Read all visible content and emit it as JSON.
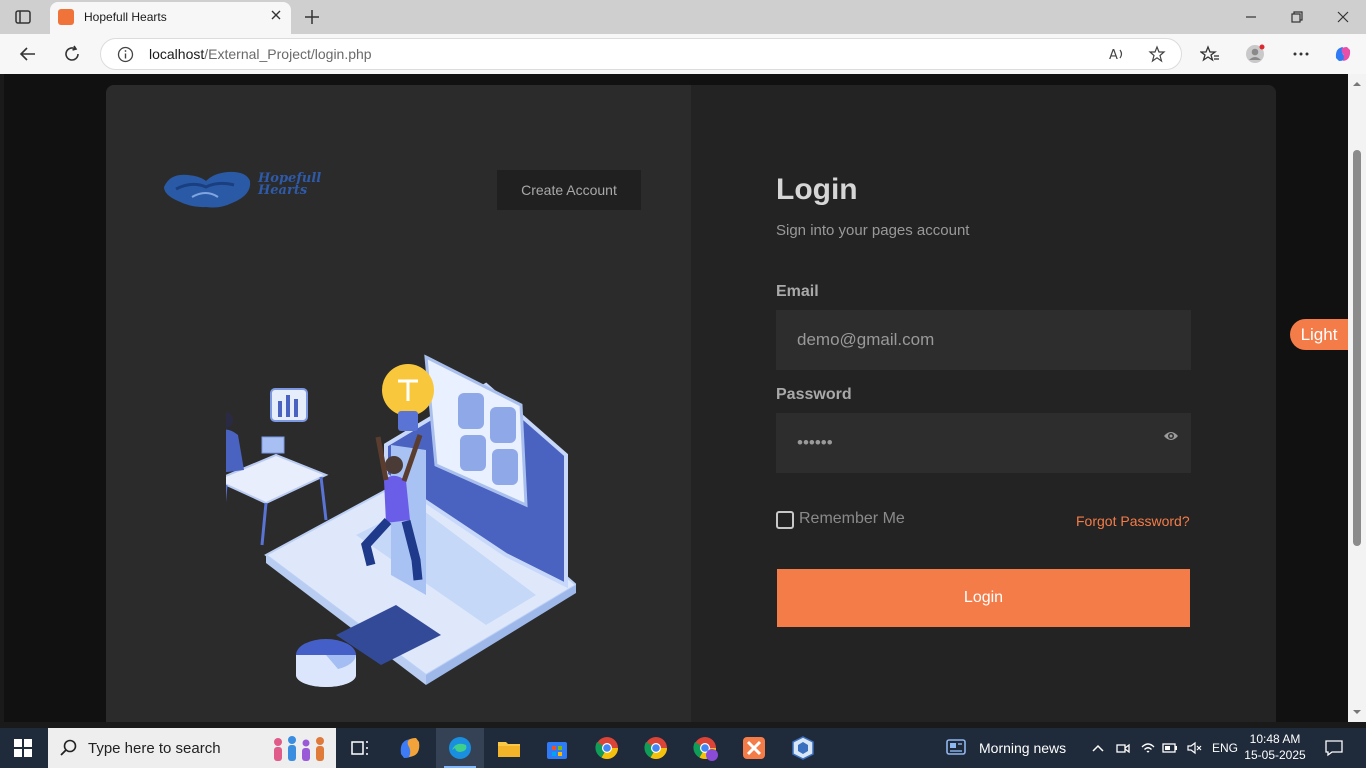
{
  "browser": {
    "tab_title": "Hopefull Hearts",
    "url_host": "localhost",
    "url_path": "/External_Project/login.php"
  },
  "brand": {
    "logo_line1": "Hopefull",
    "logo_line2": "Hearts",
    "accent": "#f47c48",
    "logo_color": "#2e5aa8"
  },
  "left": {
    "create_account_label": "Create Account"
  },
  "login": {
    "heading": "Login",
    "subtitle": "Sign into your pages account",
    "email_label": "Email",
    "email_placeholder": "demo@gmail.com",
    "password_label": "Password",
    "password_value": "••••••",
    "remember_label": "Remember Me",
    "forgot_label": "Forgot Password?",
    "submit_label": "Login"
  },
  "theme_toggle": {
    "label": "Light"
  },
  "taskbar": {
    "search_placeholder": "Type here to search",
    "news_label": "Morning news",
    "language": "ENG",
    "time": "10:48 AM",
    "date": "15-05-2025"
  }
}
